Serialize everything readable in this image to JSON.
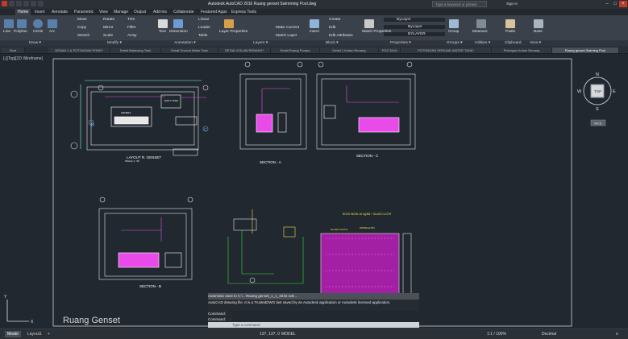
{
  "window": {
    "title": "Autodesk AutoCAD 2016   Ruang genset Swimming Pool.dwg",
    "search_placeholder": "Type a keyword or phrase",
    "user": "Sign In"
  },
  "ribbon_tabs": [
    "Home",
    "Insert",
    "Annotate",
    "Parametric",
    "View",
    "Manage",
    "Output",
    "Add-ins",
    "Collaborate",
    "Featured Apps",
    "Express Tools"
  ],
  "ribbon": {
    "draw": {
      "line": "Line",
      "polyline": "Polyline",
      "circle": "Circle",
      "arc": "Arc"
    },
    "modify": {
      "move": "Move",
      "rotate": "Rotate",
      "trim": "Trim",
      "copy": "Copy",
      "mirror": "Mirror",
      "fillet": "Fillet",
      "stretch": "Stretch",
      "scale": "Scale",
      "array": "Array"
    },
    "annotation": {
      "text": "Text",
      "dimension": "Dimension",
      "linear": "Linear",
      "leader": "Leader",
      "table": "Table"
    },
    "layers": {
      "layer_properties": "Layer Properties",
      "make_current": "Make Current",
      "match_layer": "Match Layer"
    },
    "block": {
      "insert": "Insert",
      "create": "Create",
      "edit": "Edit",
      "edit_attributes": "Edit Attributes"
    },
    "properties": {
      "match_properties": "Match Properties",
      "bylayer_1": "ByLayer",
      "bylayer_2": "ByLayer",
      "bylayer_3": "BYLAYER"
    },
    "groups": {
      "group": "Group"
    },
    "utilities": {
      "measure": "Measure"
    },
    "clipboard": {
      "paste": "Paste"
    },
    "view": {
      "base": "Base"
    }
  },
  "panel_titles": [
    "Draw ▾",
    "Modify ▾",
    "Annotation ▾",
    "Layers ▾",
    "Block ▾",
    "Properties ▾",
    "Groups ▾",
    "Utilities ▾",
    "Clipboard",
    "View ▾"
  ],
  "doc_tabs": [
    "Start",
    "DENAH 1 & POTONGAN POND*",
    "Detail Balancing Tank",
    "Detail Ground Water Tank",
    "DETAIL KOLAM RENANG*",
    "Detail Ruang Pompa",
    "Detail 1 Kolam Renang",
    "PCS 3444",
    "POTONGAN GROUND WATER TANK*",
    "Potongan Kolam Renang",
    "Ruang genset Swiming Pool"
  ],
  "viewport_label": "[-][Top][2D Wireframe]",
  "navcube": {
    "top": "TOP",
    "north": "N",
    "south": "S",
    "east": "E",
    "west": "W",
    "wcs": "WCS"
  },
  "drawing": {
    "sheet_title": "Ruang Genset",
    "layout_title": "LAYOUT R. GENSET",
    "section_a": "SECTION - A",
    "section_c": "SECTION - C",
    "section_b": "SECTION - B",
    "detail_rock": "DETAIL ROCK WOOL + GLASS CLOTH",
    "scale": "SKALA 1 : 50",
    "rock_note": "ROCK WOOL 40 Kg/M3 + GLASS CLOTH",
    "glass_cloth": "GLASS CLOTH",
    "spindle": "SPINDLE PIN",
    "genset_label": "GENSET",
    "silencer": "SILENCER",
    "fuel_tank": "DAILY TANK"
  },
  "command": {
    "history": "Automatic save to C:\\...\\Ruang genset_1_1_3210.sv$ ...",
    "warning": "AutoCAD drawing file. It is a TrustedDWG last saved by an Autodesk application or Autodesk licensed application.",
    "cmd1": "Command:",
    "cmd2": "Command:",
    "prompt": "Type a command"
  },
  "status": {
    "model_tab": "Model",
    "layout_tab": "Layout1",
    "coords": "137, 137, 0",
    "mode": "MODEL",
    "scale": "1:1 / 100%",
    "units": "Decimal"
  }
}
